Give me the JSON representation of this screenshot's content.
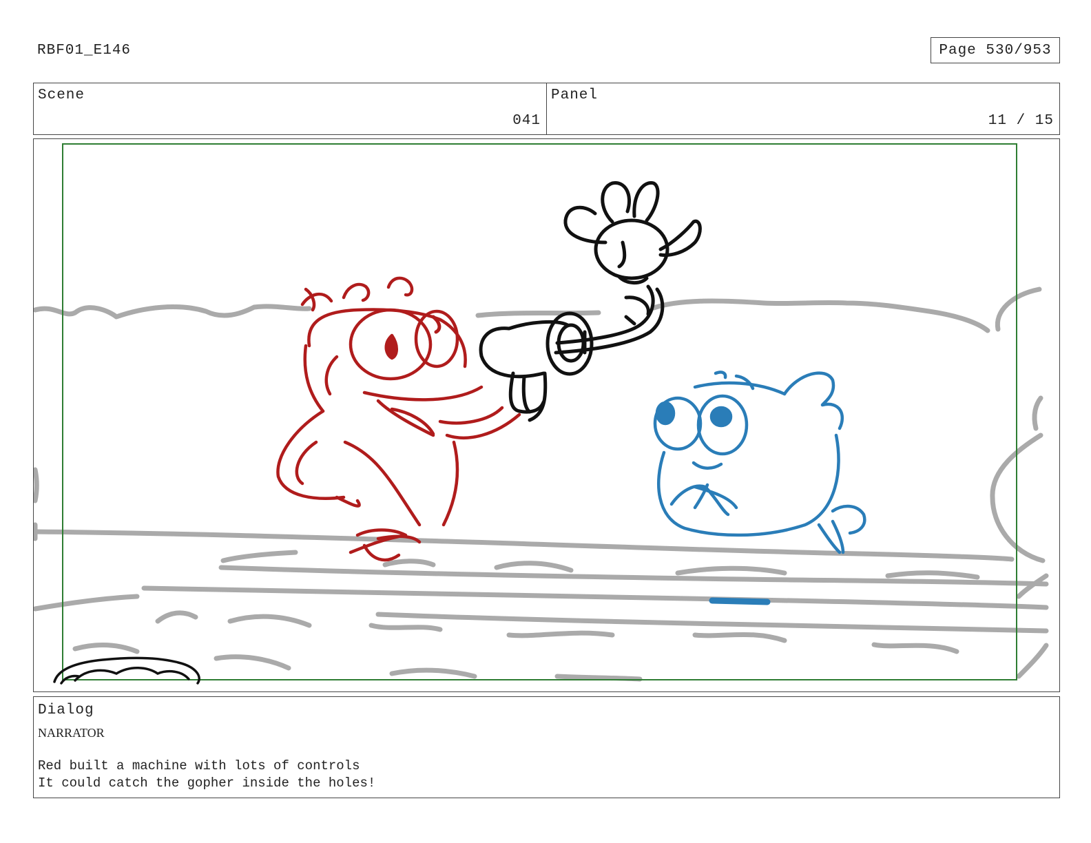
{
  "header": {
    "project_code": "RBF01_E146",
    "page_label": "Page 530/953"
  },
  "info": {
    "scene_label": "Scene",
    "scene_value": "041",
    "panel_label": "Panel",
    "panel_value": "11 / 15"
  },
  "panel": {
    "safe_area_color": "#2e7d32",
    "colors": {
      "red_character": "#b01c1c",
      "blue_character": "#2a7db8",
      "machine": "#111111",
      "background": "#aaaaaa"
    }
  },
  "dialog": {
    "label": "Dialog",
    "speaker": "NARRATOR",
    "lines": [
      "Red built a machine with lots of controls",
      "It could catch the gopher inside the holes!"
    ]
  }
}
